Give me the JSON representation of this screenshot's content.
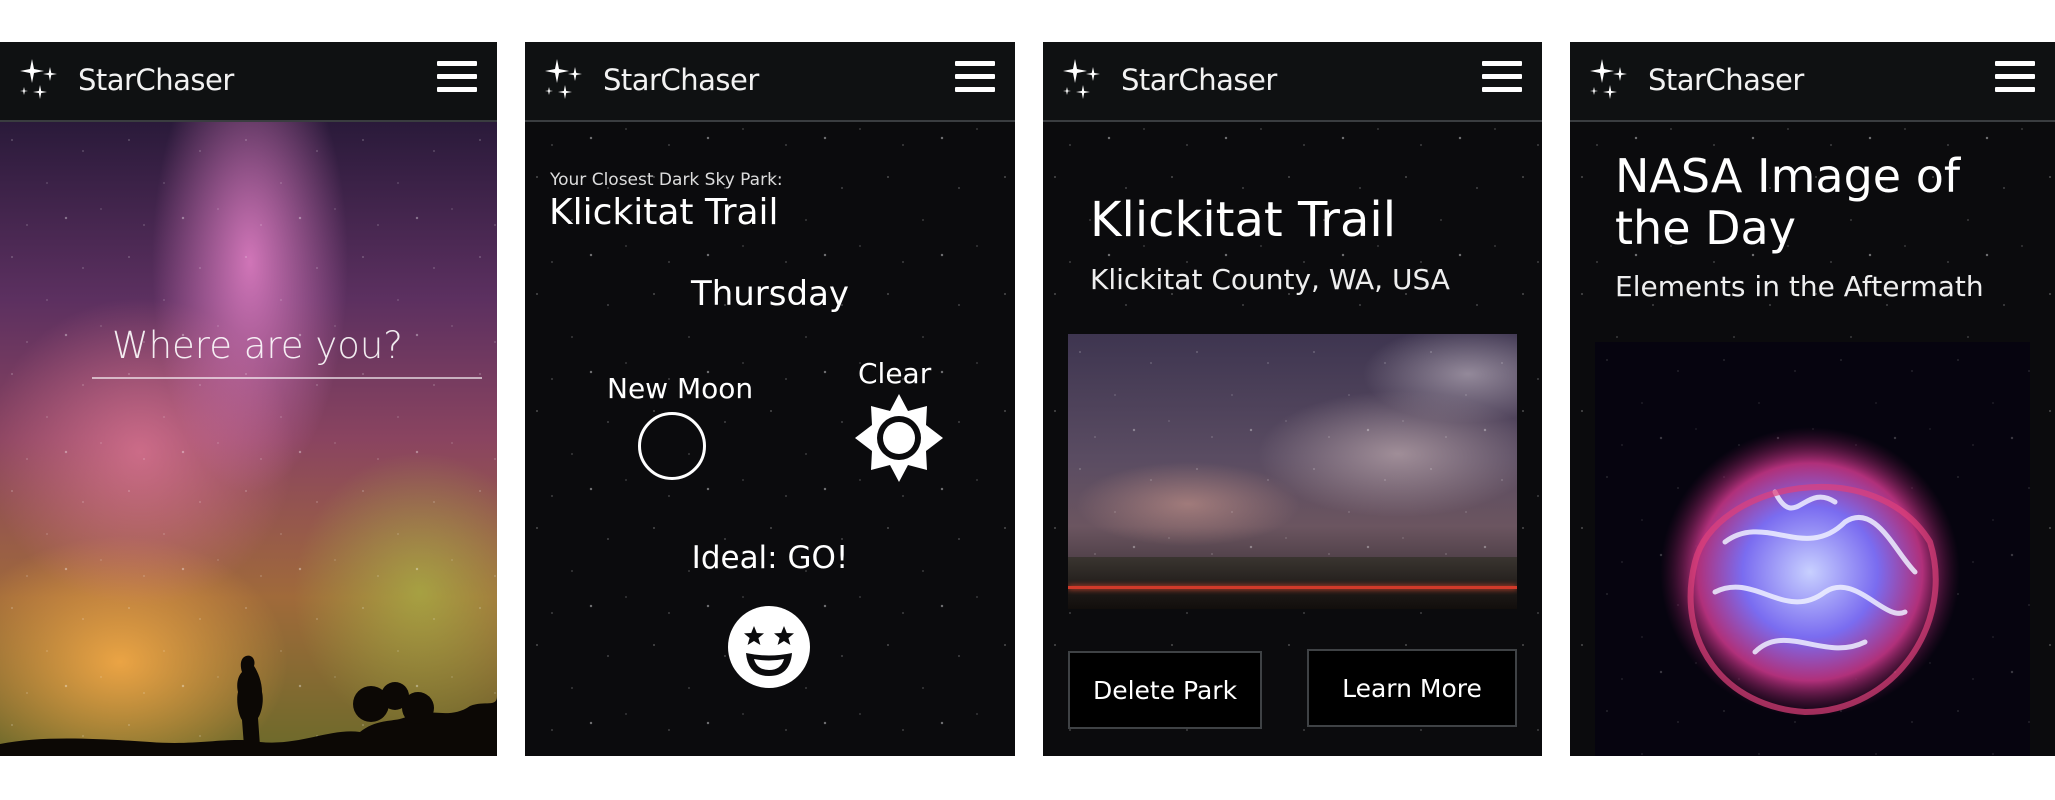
{
  "app": {
    "brand": "StarChaser"
  },
  "screen1": {
    "search": {
      "placeholder": "Where are you?"
    }
  },
  "screen2": {
    "closest_label": "Your Closest Dark Sky Park:",
    "park_name": "Klickitat Trail",
    "day": "Thursday",
    "moon_phase": "New Moon",
    "weather": "Clear",
    "verdict": "Ideal: GO!",
    "icons": {
      "moon": "new-moon-icon",
      "weather": "sun-icon",
      "verdict": "star-eyes-face-icon"
    }
  },
  "screen3": {
    "park_name": "Klickitat Trail",
    "park_location": "Klickitat County, WA, USA",
    "delete_label": "Delete Park",
    "learn_label": "Learn More"
  },
  "screen4": {
    "title": "NASA Image of the Day",
    "subtitle": "Elements in the Aftermath"
  },
  "colors": {
    "appbar": "#0f1112",
    "background": "#0b0b0d",
    "text": "#ffffff"
  }
}
